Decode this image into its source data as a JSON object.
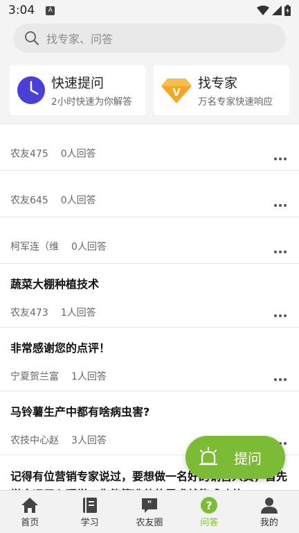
{
  "status_bar": {
    "time": "3:04",
    "notif_glyph": "A"
  },
  "search": {
    "placeholder": "找专家、问答"
  },
  "quick_cards": [
    {
      "title": "快速提问",
      "subtitle": "2小时快速为你解答",
      "icon": "clock-icon",
      "color": "#4a3fd6"
    },
    {
      "title": "找专家",
      "subtitle": "万名专家快速响应",
      "icon": "diamond-v-icon",
      "color": "#f5a623"
    }
  ],
  "questions": [
    {
      "title": "",
      "user": "农友475",
      "answers": "0人回答"
    },
    {
      "title": "",
      "user": "农友645",
      "answers": "0人回答"
    },
    {
      "title": "",
      "user": "柯军连（维",
      "answers": "0人回答"
    },
    {
      "title": "蔬菜大棚种植技术",
      "user": "农友473",
      "answers": "1人回答"
    },
    {
      "title": "非常感谢您的点评！",
      "user": "宁夏贺兰富",
      "answers": "1人回答"
    },
    {
      "title": "马铃薯生产中都有啥病虫害?",
      "user": "农技中心赵",
      "answers": "3人回答"
    },
    {
      "title": "记得有位营销专家说过，要想做一名好的销售人员，首先学会运用心理学，你能算准他的需求就能成功的",
      "user": "",
      "answers": ""
    }
  ],
  "fab": {
    "label": "提问",
    "color": "#7cbc34"
  },
  "tabs": [
    {
      "label": "首页",
      "icon": "home-icon",
      "active": false
    },
    {
      "label": "学习",
      "icon": "book-icon",
      "active": false
    },
    {
      "label": "农友圈",
      "icon": "chat-quote-icon",
      "active": false
    },
    {
      "label": "问答",
      "icon": "question-icon",
      "active": true
    },
    {
      "label": "我的",
      "icon": "person-icon",
      "active": false
    }
  ]
}
